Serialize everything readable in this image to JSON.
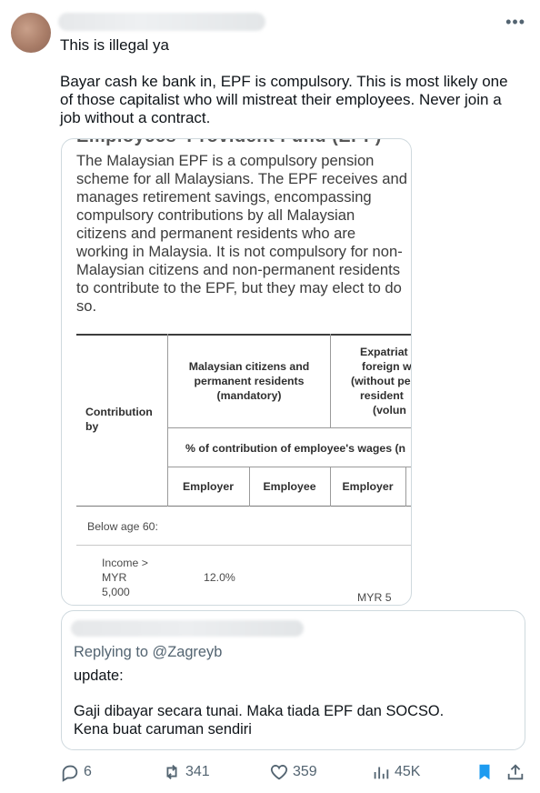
{
  "tweet": {
    "first_line": "This is illegal ya",
    "body": "Bayar cash ke bank in, EPF is compulsory. This is most likely one of those capitalist who will mistreat their employees. Never join a job without a contract."
  },
  "media": {
    "cut_heading": "Employees' Provident Fund (EPF)",
    "paragraph": "The Malaysian EPF is a compulsory pension scheme for all Malaysians. The EPF receives and manages retirement savings, encompassing compulsory contributions by all Malaysian citizens and permanent residents who are working in Malaysia. It is not compulsory for non-Malaysian citizens and non-permanent residents to contribute to the EPF, but they may elect to do so.",
    "table": {
      "contribution_by": "Contribution by",
      "group_citizens": "Malaysian citizens and permanent residents (mandatory)",
      "group_expat_l1": "Expatriat",
      "group_expat_l2": "foreign w",
      "group_expat_l3": "(without pe",
      "group_expat_l4": "resident",
      "group_expat_l5": "(volun",
      "pct_row": "% of contribution of employee's wages (n",
      "col_employer": "Employer",
      "col_employee": "Employee",
      "col_employer_2": "Employer",
      "section_label": "Below age 60:",
      "row_income_l1": "Income >",
      "row_income_l2": "MYR",
      "row_income_l3": "5,000",
      "row_employer_value": "12.0%",
      "row_expat_value": "MYR 5"
    }
  },
  "quote": {
    "replying_to": "Replying to @Zagreyb",
    "line1": "update:",
    "line2": "Gaji dibayar secara tunai. Maka tiada EPF dan SOCSO.",
    "line3": "Kena buat caruman sendiri"
  },
  "actions": {
    "replies": "6",
    "reposts": "341",
    "likes": "359",
    "views": "45K"
  },
  "colors": {
    "muted": "#536471",
    "bookmark_active": "#1d9bf0",
    "border": "#cfd9de"
  }
}
